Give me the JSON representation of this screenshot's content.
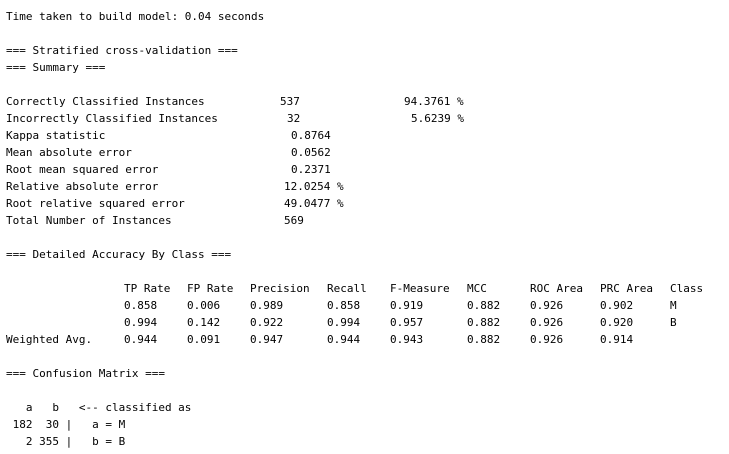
{
  "output": {
    "build_time": "Time taken to build model: 0.04 seconds",
    "cv_header": "=== Stratified cross-validation ===",
    "summary_header": "=== Summary ===",
    "summary": [
      {
        "label": "Correctly Classified Instances",
        "value": "537",
        "percent": "94.3761 %"
      },
      {
        "label": "Incorrectly Classified Instances",
        "value": "32",
        "percent": "5.6239 %"
      },
      {
        "label": "Kappa statistic",
        "value": "0.8764",
        "percent": ""
      },
      {
        "label": "Mean absolute error",
        "value": "0.0562",
        "percent": ""
      },
      {
        "label": "Root mean squared error",
        "value": "0.2371",
        "percent": ""
      },
      {
        "label": "Relative absolute error",
        "value": "12.0254 %",
        "percent": ""
      },
      {
        "label": "Root relative squared error",
        "value": "49.0477 %",
        "percent": ""
      },
      {
        "label": "Total Number of Instances",
        "value": "569",
        "percent": ""
      }
    ],
    "detailed_header": "=== Detailed Accuracy By Class ===",
    "accuracy_columns": [
      "TP Rate",
      "FP Rate",
      "Precision",
      "Recall",
      "F-Measure",
      "MCC",
      "ROC Area",
      "PRC Area",
      "Class"
    ],
    "accuracy_rows": [
      {
        "label": "",
        "cells": [
          "0.858",
          "0.006",
          "0.989",
          "0.858",
          "0.919",
          "0.882",
          "0.926",
          "0.902",
          "M"
        ]
      },
      {
        "label": "",
        "cells": [
          "0.994",
          "0.142",
          "0.922",
          "0.994",
          "0.957",
          "0.882",
          "0.926",
          "0.920",
          "B"
        ]
      },
      {
        "label": "Weighted Avg.",
        "cells": [
          "0.944",
          "0.091",
          "0.947",
          "0.944",
          "0.943",
          "0.882",
          "0.926",
          "0.914",
          ""
        ]
      }
    ],
    "confusion_header": "=== Confusion Matrix ===",
    "confusion_lines": [
      "   a   b   <-- classified as",
      " 182  30 |   a = M",
      "   2 355 |   b = B"
    ]
  }
}
